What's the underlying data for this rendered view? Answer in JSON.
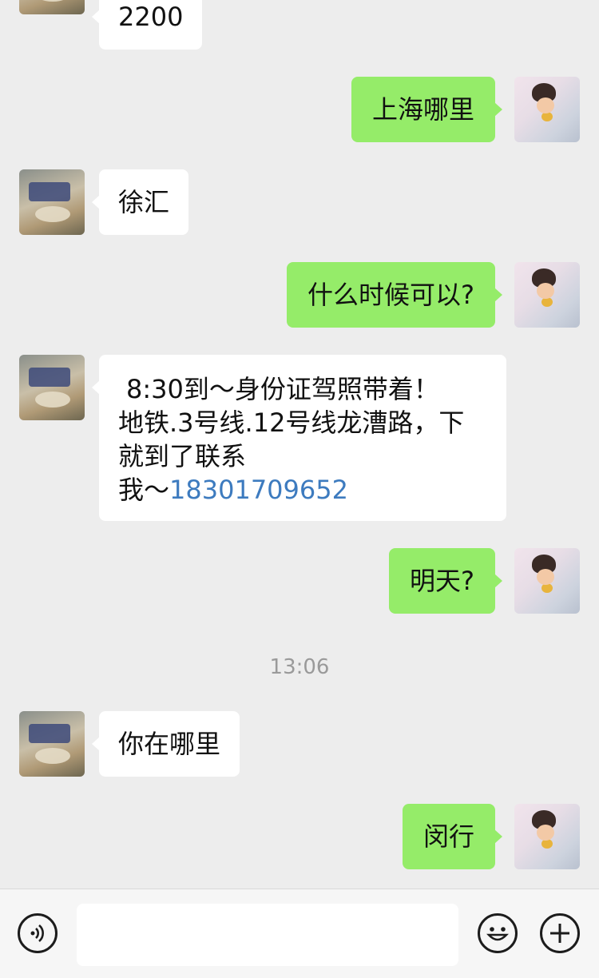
{
  "messages": [
    {
      "side": "in",
      "text": "2200"
    },
    {
      "side": "out",
      "text": "上海哪里"
    },
    {
      "side": "in",
      "text": "徐汇"
    },
    {
      "side": "out",
      "text": "什么时候可以?"
    },
    {
      "side": "in",
      "lines": [
        "8:30到～身份证驾照带着！",
        "地铁.3号线.12号线龙漕路，下",
        "就到了联系"
      ],
      "prefix": "我～",
      "phone": "18301709652"
    },
    {
      "side": "out",
      "text": "明天?"
    },
    {
      "side": "time",
      "text": "13:06"
    },
    {
      "side": "in",
      "text": "你在哪里"
    },
    {
      "side": "out",
      "text": "闵行"
    }
  ],
  "input": {
    "value": ""
  },
  "icons": {
    "voice": "voice-icon",
    "emoji": "emoji-icon",
    "more": "plus-icon"
  }
}
